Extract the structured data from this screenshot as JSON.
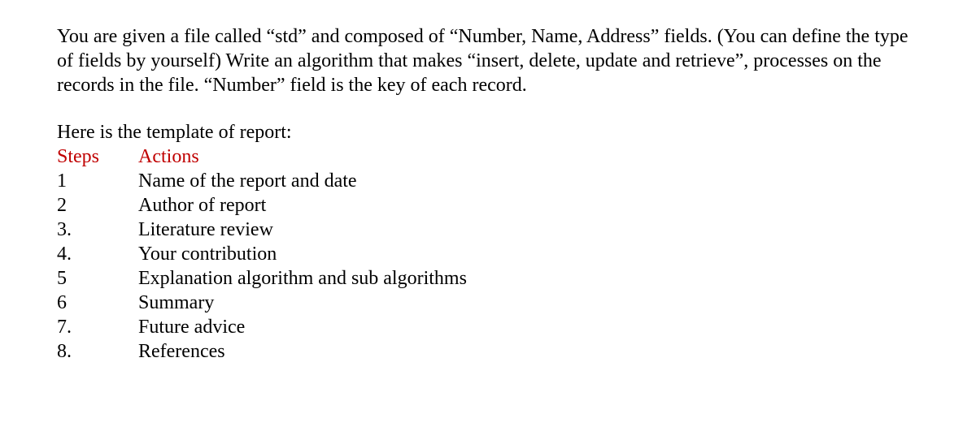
{
  "paragraph1": "You are given a file called “std” and composed of “Number, Name, Address” fields. (You can define the type of fields by yourself) Write an algorithm that makes “insert, delete, update and retrieve”, processes on the records in the file. “Number” field is the key of each record.",
  "template_intro": "Here is the template of report:",
  "header": {
    "steps_label": "Steps",
    "actions_label": "Actions"
  },
  "rows": [
    {
      "step": "1",
      "action": "Name of the report and date"
    },
    {
      "step": "2",
      "action": "Author of report"
    },
    {
      "step": "3.",
      "action": "Literature review"
    },
    {
      "step": "4.",
      "action": "Your contribution"
    },
    {
      "step": "5",
      "action": "Explanation algorithm and sub algorithms"
    },
    {
      "step": "6",
      "action": "Summary"
    },
    {
      "step": "7.",
      "action": "Future advice"
    },
    {
      "step": "8.",
      "action": "References"
    }
  ]
}
